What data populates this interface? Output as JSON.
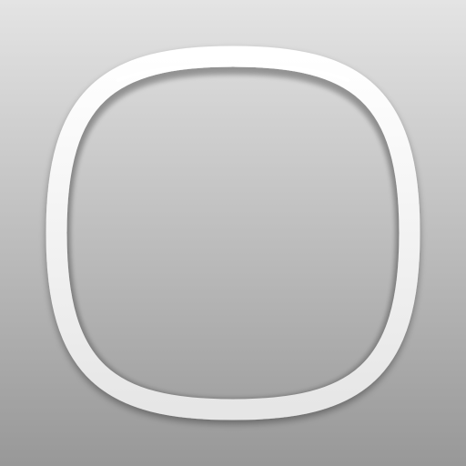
{
  "icon": {
    "name": "rounded-square-ring-icon",
    "background_top_color": "#e4e4e4",
    "background_bottom_color": "#989898",
    "ring_color": "#ffffff",
    "ring_shade_color": "#e6e6e6"
  }
}
